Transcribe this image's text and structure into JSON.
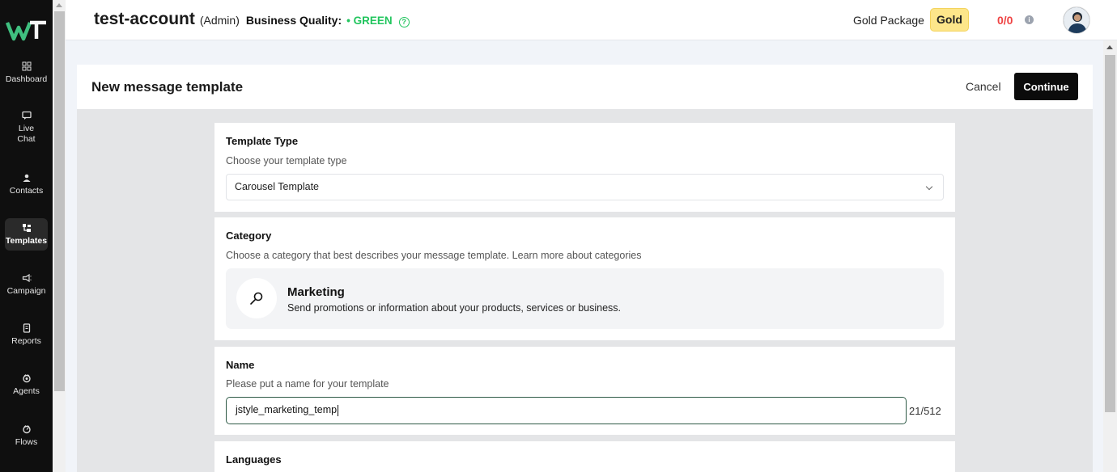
{
  "sidebar": {
    "logo_text": "WT",
    "items": [
      {
        "label": "Dashboard",
        "icon": "dashboard-icon"
      },
      {
        "label": "Live Chat",
        "icon": "chat-icon"
      },
      {
        "label": "Contacts",
        "icon": "user-icon"
      },
      {
        "label": "Templates",
        "icon": "templates-icon",
        "active": true
      },
      {
        "label": "Campaign",
        "icon": "megaphone-icon"
      },
      {
        "label": "Reports",
        "icon": "report-icon"
      },
      {
        "label": "Agents",
        "icon": "agent-icon"
      },
      {
        "label": "Flows",
        "icon": "flow-icon"
      }
    ]
  },
  "topbar": {
    "account_name": "test-account",
    "role": "(Admin)",
    "quality_label": "Business Quality:",
    "quality_value": "• GREEN",
    "package_label": "Gold Package",
    "package_badge": "Gold",
    "counter": "0/0",
    "colors": {
      "quality": "#22c55e",
      "counter": "#ef4444",
      "badge": "#fde68a"
    }
  },
  "header": {
    "title": "New message template",
    "cancel_label": "Cancel",
    "continue_label": "Continue"
  },
  "template_type": {
    "title": "Template Type",
    "subtitle": "Choose your template type",
    "selected": "Carousel Template"
  },
  "category": {
    "title": "Category",
    "subtitle": "Choose a category that best describes your message template. Learn more about categories",
    "option_name": "Marketing",
    "option_desc": "Send promotions or information about your products, services or business."
  },
  "name_section": {
    "title": "Name",
    "subtitle": "Please put a name for your template",
    "value": "jstyle_marketing_temp",
    "counter": "21/512"
  },
  "languages": {
    "title": "Languages"
  }
}
